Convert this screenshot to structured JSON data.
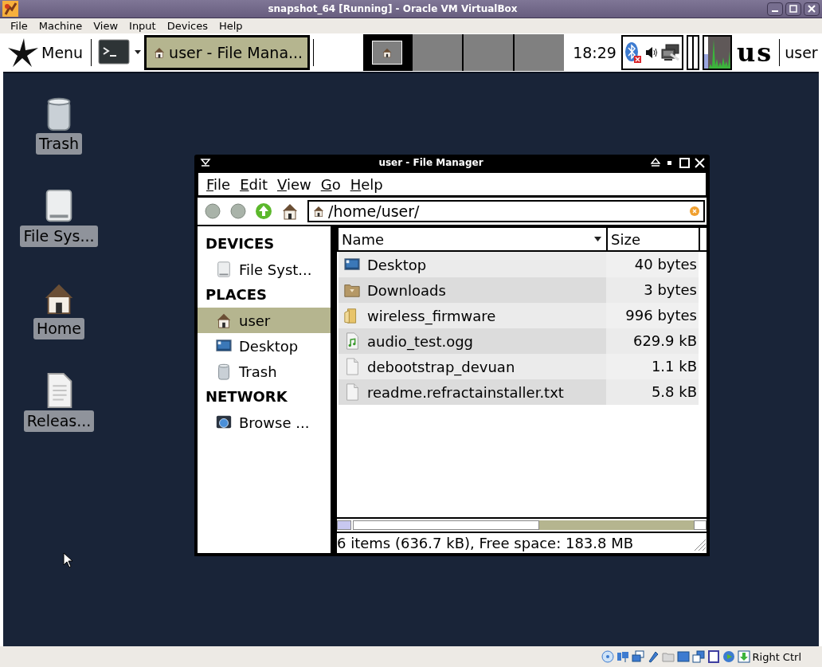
{
  "window": {
    "title": "snapshot_64 [Running] - Oracle VM VirtualBox"
  },
  "menu_bar": [
    "File",
    "Machine",
    "View",
    "Input",
    "Devices",
    "Help"
  ],
  "guest_panel": {
    "menu_label": "Menu",
    "tasks": [
      {
        "label": "user - File Mana...",
        "selected": true
      }
    ],
    "workspaces": [
      {
        "selected": true
      },
      {
        "selected": false
      },
      {
        "selected": false
      },
      {
        "selected": false
      }
    ],
    "clock": "18:29",
    "keyboard_layout": "us",
    "user": "user"
  },
  "desktop_icons": [
    {
      "label": "Trash",
      "kind": "trash"
    },
    {
      "label": "File Sys...",
      "kind": "drive"
    },
    {
      "label": "Home",
      "kind": "home"
    },
    {
      "label": "Releas...",
      "kind": "document"
    }
  ],
  "file_manager": {
    "title": "user - File Manager",
    "menu": [
      "File",
      "Edit",
      "View",
      "Go",
      "Help"
    ],
    "location": "/home/user/",
    "sidebar": [
      {
        "heading": "DEVICES",
        "items": [
          {
            "label": "File Syst...",
            "kind": "drive",
            "selected": false
          }
        ]
      },
      {
        "heading": "PLACES",
        "items": [
          {
            "label": "user",
            "kind": "home",
            "selected": true
          },
          {
            "label": "Desktop",
            "kind": "desktop",
            "selected": false
          },
          {
            "label": "Trash",
            "kind": "trash",
            "selected": false
          }
        ]
      },
      {
        "heading": "NETWORK",
        "items": [
          {
            "label": "Browse ...",
            "kind": "network",
            "selected": false
          }
        ]
      }
    ],
    "columns": [
      "Name",
      "Size"
    ],
    "rows": [
      {
        "name": "Desktop",
        "size": "40 bytes",
        "kind": "desktop"
      },
      {
        "name": "Downloads",
        "size": "3 bytes",
        "kind": "download-folder"
      },
      {
        "name": "wireless_firmware",
        "size": "996 bytes",
        "kind": "folder"
      },
      {
        "name": "audio_test.ogg",
        "size": "629.9 kB",
        "kind": "audio"
      },
      {
        "name": "debootstrap_devuan",
        "size": "1.1 kB",
        "kind": "file"
      },
      {
        "name": "readme.refractainstaller.txt",
        "size": "5.8 kB",
        "kind": "file"
      }
    ],
    "status": "6 items (636.7 kB), Free space: 183.8 MB"
  },
  "status_bar": {
    "host_key": "Right Ctrl"
  }
}
